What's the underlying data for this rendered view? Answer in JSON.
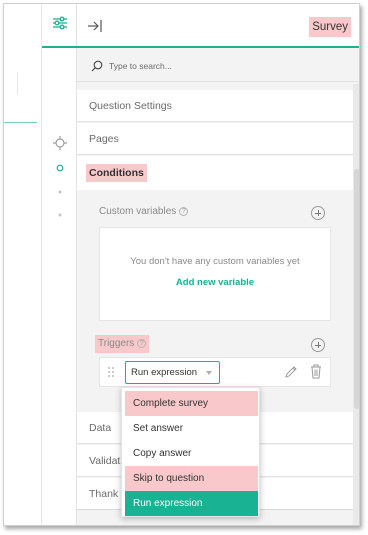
{
  "header": {
    "title": "Survey"
  },
  "search": {
    "placeholder": "Type to search..."
  },
  "sections": {
    "question_settings": "Question Settings",
    "pages": "Pages",
    "conditions": "Conditions"
  },
  "conditions": {
    "custom_variables_label": "Custom variables",
    "empty_text": "You don't have any custom variables yet",
    "add_variable_link": "Add new variable",
    "triggers_label": "Triggers",
    "help_glyph": "?",
    "trigger_type_value": "Run expression"
  },
  "lower_sections": {
    "data": "Data",
    "validation": "Validati",
    "thank_you": "Thank Y"
  },
  "dropdown": {
    "options": [
      "Complete survey",
      "Set answer",
      "Copy answer",
      "Skip to question",
      "Run expression"
    ],
    "selected": "Run expression"
  },
  "colors": {
    "accent": "#19b394",
    "highlight": "#f8c8cb",
    "panel_bg": "#f3f3f3"
  },
  "icons": {
    "settings": "sliders-icon",
    "collapse": "collapse-right-icon",
    "search": "search-icon",
    "tools": [
      "select-target-icon",
      "circle-icon",
      "dot-icon",
      "dot-icon"
    ],
    "trigger_actions": [
      "pencil-icon",
      "trash-icon"
    ]
  }
}
